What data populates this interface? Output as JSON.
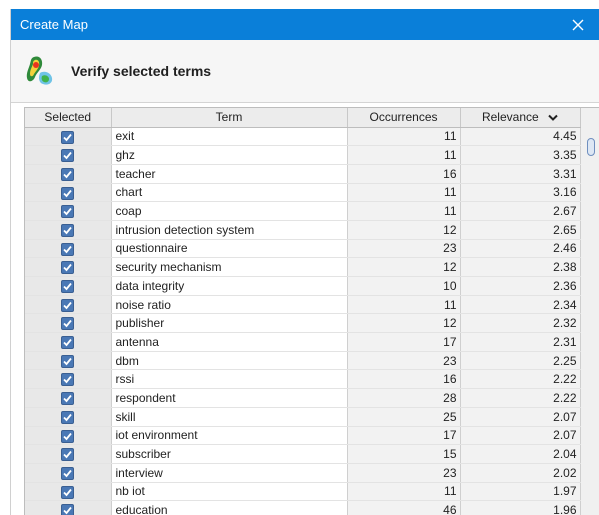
{
  "window": {
    "title": "Create Map",
    "heading": "Verify selected terms"
  },
  "table": {
    "headers": {
      "selected": "Selected",
      "term": "Term",
      "occurrences": "Occurrences",
      "relevance": "Relevance"
    },
    "sort_indicator_icon": "chevron-down-icon",
    "rows": [
      {
        "selected": true,
        "term": "exit",
        "occurrences": "11",
        "relevance": "4.45"
      },
      {
        "selected": true,
        "term": "ghz",
        "occurrences": "11",
        "relevance": "3.35"
      },
      {
        "selected": true,
        "term": "teacher",
        "occurrences": "16",
        "relevance": "3.31"
      },
      {
        "selected": true,
        "term": "chart",
        "occurrences": "11",
        "relevance": "3.16"
      },
      {
        "selected": true,
        "term": "coap",
        "occurrences": "11",
        "relevance": "2.67"
      },
      {
        "selected": true,
        "term": "intrusion detection system",
        "occurrences": "12",
        "relevance": "2.65"
      },
      {
        "selected": true,
        "term": "questionnaire",
        "occurrences": "23",
        "relevance": "2.46"
      },
      {
        "selected": true,
        "term": "security mechanism",
        "occurrences": "12",
        "relevance": "2.38"
      },
      {
        "selected": true,
        "term": "data integrity",
        "occurrences": "10",
        "relevance": "2.36"
      },
      {
        "selected": true,
        "term": "noise ratio",
        "occurrences": "11",
        "relevance": "2.34"
      },
      {
        "selected": true,
        "term": "publisher",
        "occurrences": "12",
        "relevance": "2.32"
      },
      {
        "selected": true,
        "term": "antenna",
        "occurrences": "17",
        "relevance": "2.31"
      },
      {
        "selected": true,
        "term": "dbm",
        "occurrences": "23",
        "relevance": "2.25"
      },
      {
        "selected": true,
        "term": "rssi",
        "occurrences": "16",
        "relevance": "2.22"
      },
      {
        "selected": true,
        "term": "respondent",
        "occurrences": "28",
        "relevance": "2.22"
      },
      {
        "selected": true,
        "term": "skill",
        "occurrences": "25",
        "relevance": "2.07"
      },
      {
        "selected": true,
        "term": "iot environment",
        "occurrences": "17",
        "relevance": "2.07"
      },
      {
        "selected": true,
        "term": "subscriber",
        "occurrences": "15",
        "relevance": "2.04"
      },
      {
        "selected": true,
        "term": "interview",
        "occurrences": "23",
        "relevance": "2.02"
      },
      {
        "selected": true,
        "term": "nb iot",
        "occurrences": "11",
        "relevance": "1.97"
      },
      {
        "selected": true,
        "term": "education",
        "occurrences": "46",
        "relevance": "1.96"
      }
    ]
  },
  "colors": {
    "titlebar": "#0a7fd9",
    "checkbox": "#4a78b5"
  }
}
